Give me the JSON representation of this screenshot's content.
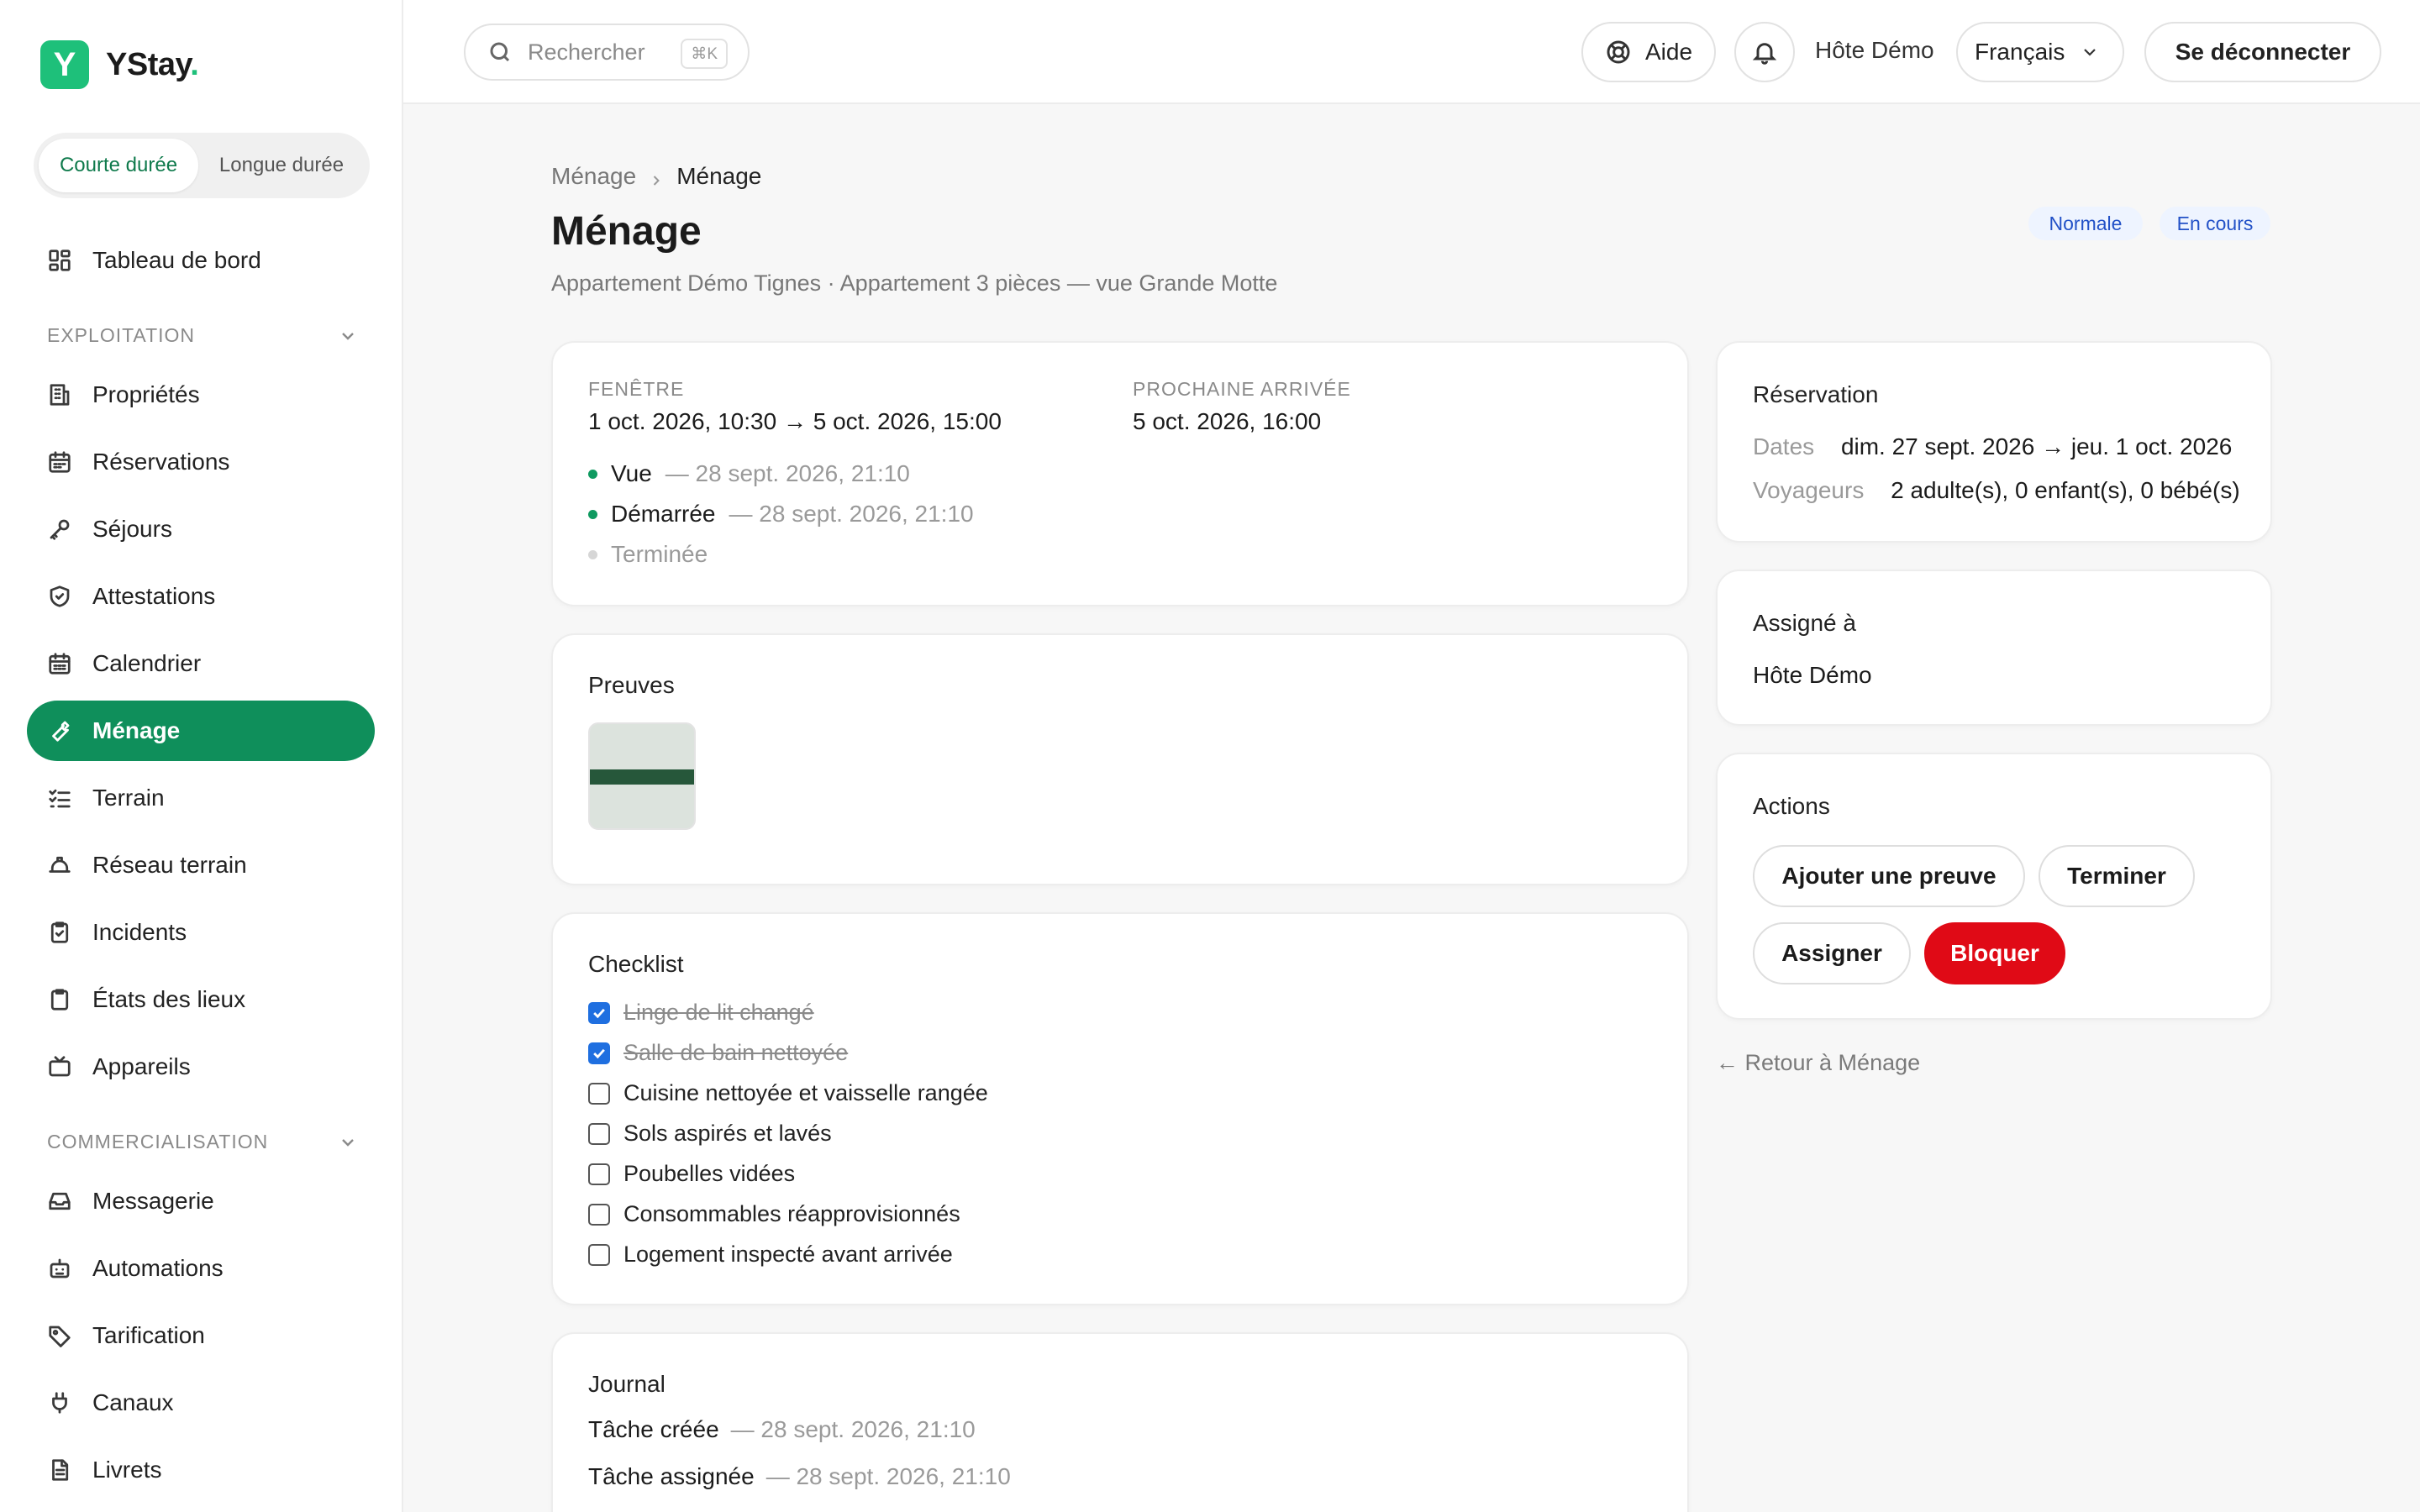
{
  "app": {
    "logo_letter": "Y",
    "name": "YStay",
    "name_dot": "."
  },
  "duration_toggle": {
    "active": "Courte durée",
    "inactive": "Longue durée"
  },
  "sidebar": {
    "dashboard": "Tableau de bord",
    "section_exploitation": "EXPLOITATION",
    "exploitation_items": [
      {
        "label": "Propriétés",
        "icon": "building-icon"
      },
      {
        "label": "Réservations",
        "icon": "calendar-icon"
      },
      {
        "label": "Séjours",
        "icon": "key-icon"
      },
      {
        "label": "Attestations",
        "icon": "shield-icon"
      },
      {
        "label": "Calendrier",
        "icon": "calendar-grid-icon"
      },
      {
        "label": "Ménage",
        "icon": "wrench-icon"
      },
      {
        "label": "Terrain",
        "icon": "checklist-icon"
      },
      {
        "label": "Réseau terrain",
        "icon": "hardhat-icon"
      },
      {
        "label": "Incidents",
        "icon": "clipboard-check-icon"
      },
      {
        "label": "États des lieux",
        "icon": "clipboard-icon"
      },
      {
        "label": "Appareils",
        "icon": "tv-icon"
      }
    ],
    "section_commercialisation": "COMMERCIALISATION",
    "commercialisation_items": [
      {
        "label": "Messagerie",
        "icon": "inbox-icon"
      },
      {
        "label": "Automations",
        "icon": "bot-icon"
      },
      {
        "label": "Tarification",
        "icon": "tag-icon"
      },
      {
        "label": "Canaux",
        "icon": "plug-icon"
      },
      {
        "label": "Livrets",
        "icon": "document-icon"
      }
    ]
  },
  "topbar": {
    "search_placeholder": "Rechercher",
    "search_shortcut": "⌘K",
    "help": "Aide",
    "host": "Hôte Démo",
    "language": "Français",
    "logout": "Se déconnecter"
  },
  "breadcrumb": {
    "parent": "Ménage",
    "current": "Ménage"
  },
  "page": {
    "title": "Ménage",
    "subtitle": "Appartement Démo Tignes · Appartement 3 pièces — vue Grande Motte",
    "badges": [
      "Normale",
      "En cours"
    ]
  },
  "window_card": {
    "window_label": "FENÊTRE",
    "window_value": "1 oct. 2026, 10:30 → 5 oct. 2026, 15:00",
    "next_arrival_label": "PROCHAINE ARRIVÉE",
    "next_arrival_value": "5 oct. 2026, 16:00",
    "timeline": [
      {
        "label": "Vue",
        "time": "— 28 sept. 2026, 21:10",
        "done": true
      },
      {
        "label": "Démarrée",
        "time": "— 28 sept. 2026, 21:10",
        "done": true
      },
      {
        "label": "Terminée",
        "time": "",
        "done": false
      }
    ]
  },
  "proofs": {
    "title": "Preuves"
  },
  "checklist": {
    "title": "Checklist",
    "items": [
      {
        "label": "Linge de lit changé",
        "checked": true
      },
      {
        "label": "Salle de bain nettoyée",
        "checked": true
      },
      {
        "label": "Cuisine nettoyée et vaisselle rangée",
        "checked": false
      },
      {
        "label": "Sols aspirés et lavés",
        "checked": false
      },
      {
        "label": "Poubelles vidées",
        "checked": false
      },
      {
        "label": "Consommables réapprovisionnés",
        "checked": false
      },
      {
        "label": "Logement inspecté avant arrivée",
        "checked": false
      }
    ]
  },
  "journal": {
    "title": "Journal",
    "entries": [
      {
        "label": "Tâche créée",
        "time": "— 28 sept. 2026, 21:10"
      },
      {
        "label": "Tâche assignée",
        "time": "— 28 sept. 2026, 21:10"
      }
    ]
  },
  "reservation": {
    "title": "Réservation",
    "dates_label": "Dates",
    "dates_value": "dim. 27 sept. 2026 → jeu. 1 oct. 2026",
    "guests_label": "Voyageurs",
    "guests_value": "2 adulte(s), 0 enfant(s), 0 bébé(s)"
  },
  "assigned": {
    "title": "Assigné à",
    "value": "Hôte Démo"
  },
  "actions": {
    "title": "Actions",
    "add_proof": "Ajouter une preuve",
    "finish": "Terminer",
    "assign": "Assigner",
    "block": "Bloquer"
  },
  "back_link": "← Retour à Ménage",
  "colors": {
    "accent": "#0f8f5b",
    "brand": "#1ec07a",
    "danger": "#e00a16",
    "badge_text": "#2251c7"
  }
}
